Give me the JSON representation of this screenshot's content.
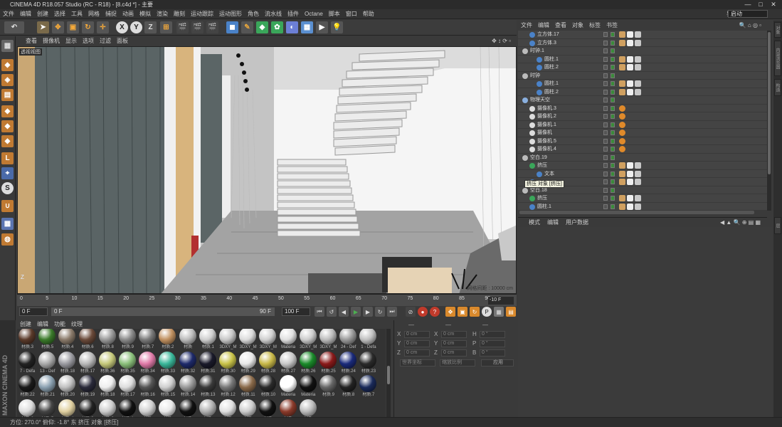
{
  "window": {
    "title": "CINEMA 4D R18.057 Studio (RC - R18) - [8.c4d *] - 主要",
    "min": "—",
    "max": "□",
    "close": "✕"
  },
  "menu": [
    "文件",
    "编辑",
    "创建",
    "选择",
    "工具",
    "网格",
    "捕捉",
    "动画",
    "模拟",
    "渲染",
    "雕刻",
    "运动跟踪",
    "运动图形",
    "角色",
    "流水线",
    "插件",
    "Octane",
    "脚本",
    "窗口",
    "帮助"
  ],
  "layout": {
    "label": "界面",
    "value": "启动"
  },
  "toolbar": {
    "x_label": "X",
    "y_label": "Y",
    "z_label": "Z"
  },
  "viewport": {
    "menu": [
      "查看",
      "摄像机",
      "显示",
      "选项",
      "过滤",
      "面板"
    ],
    "label": "透视视图",
    "scale_label": "网格间距 : 10000 cm"
  },
  "timeline": {
    "ticks": [
      "0",
      "5",
      "10",
      "15",
      "20",
      "25",
      "30",
      "35",
      "40",
      "45",
      "50",
      "55",
      "60",
      "65",
      "70",
      "75",
      "80",
      "85",
      "90"
    ],
    "end_frame": "-10 F"
  },
  "transport": {
    "start": "0 F",
    "current": "0 F",
    "range_end": "90 F",
    "max": "100 F"
  },
  "material_menu": [
    "创建",
    "编辑",
    "功能",
    "纹理"
  ],
  "materials": [
    "材质.3",
    "材质.5",
    "材质.4",
    "材质.6",
    "材质.8",
    "材质.9",
    "材质.7",
    "材质.2",
    "材质",
    "材质.1",
    "3DXY_M",
    "3DXY_M",
    "3DXY_M",
    "Materia",
    "3DXY_M",
    "3DXY_M",
    "24 - Def",
    "1 - Defa",
    "7 - Defa",
    "13 - Def",
    "材质.18",
    "材质.17",
    "材质.36",
    "材质.35",
    "材质.34",
    "材质.33",
    "材质.32",
    "材质.31",
    "材质.30",
    "材质.29",
    "材质.28",
    "材质.27",
    "材质.26",
    "材质.25",
    "材质.24",
    "材质.23",
    "材质.22",
    "材质.21",
    "材质.20",
    "材质.19",
    "材质.18",
    "材质.17",
    "材质.16",
    "材质.15",
    "材质.14",
    "材质.13",
    "材质.12",
    "材质.11",
    "材质.10",
    "Materia",
    "Materia",
    "材质.9",
    "材质.8",
    "材质.7",
    "材质.6",
    "材质.5",
    "材质.4",
    "材质.3",
    "材质.2",
    "材质.1",
    "材质",
    "材质",
    "材质",
    "材质",
    "材质",
    "材质",
    "材质",
    "材质",
    "材质"
  ],
  "coords": {
    "header": [
      "—",
      "—",
      "—"
    ],
    "rows": [
      [
        "X",
        "0 cm",
        "X",
        "0 cm",
        "H",
        "0 °"
      ],
      [
        "Y",
        "0 cm",
        "Y",
        "0 cm",
        "P",
        "0 °"
      ],
      [
        "Z",
        "0 cm",
        "Z",
        "0 cm",
        "B",
        "0 °"
      ]
    ],
    "mode1": "世界坐标",
    "mode2": "缩放比例",
    "apply": "应用"
  },
  "object_menu": [
    "文件",
    "编辑",
    "查看",
    "对象",
    "标签",
    "书签"
  ],
  "objects": [
    {
      "name": "立方体.17",
      "indent": 1,
      "icon": "cube"
    },
    {
      "name": "立方体.3",
      "indent": 1,
      "icon": "cube"
    },
    {
      "name": "时钟.1",
      "indent": 0,
      "icon": "null"
    },
    {
      "name": "圆柱.1",
      "indent": 2,
      "icon": "cyl"
    },
    {
      "name": "圆柱.2",
      "indent": 2,
      "icon": "cyl"
    },
    {
      "name": "时钟",
      "indent": 0,
      "icon": "null"
    },
    {
      "name": "圆柱.1",
      "indent": 2,
      "icon": "cyl"
    },
    {
      "name": "圆柱.2",
      "indent": 2,
      "icon": "cyl"
    },
    {
      "name": "物理天空",
      "indent": 0,
      "icon": "sky"
    },
    {
      "name": "摄像机.3",
      "indent": 1,
      "icon": "cam"
    },
    {
      "name": "摄像机.2",
      "indent": 1,
      "icon": "cam"
    },
    {
      "name": "摄像机.1",
      "indent": 1,
      "icon": "cam"
    },
    {
      "name": "摄像机",
      "indent": 1,
      "icon": "cam"
    },
    {
      "name": "摄像机.5",
      "indent": 1,
      "icon": "cam"
    },
    {
      "name": "摄像机.4",
      "indent": 1,
      "icon": "cam"
    },
    {
      "name": "空白.19",
      "indent": 0,
      "icon": "null"
    },
    {
      "name": "挤压",
      "indent": 1,
      "icon": "ext"
    },
    {
      "name": "文本",
      "indent": 2,
      "icon": "text"
    },
    {
      "name": "",
      "indent": 1,
      "icon": "cyl"
    },
    {
      "name": "空白.18",
      "indent": 0,
      "icon": "null"
    },
    {
      "name": "挤压",
      "indent": 1,
      "icon": "ext"
    },
    {
      "name": "圆柱.1",
      "indent": 1,
      "icon": "cyl"
    }
  ],
  "tooltip": "挤压 对象 [挤压]",
  "attr_menu": [
    "模式",
    "编辑",
    "用户数据"
  ],
  "side_tabs": [
    "对象",
    "内容浏览器",
    "构造",
    "层"
  ],
  "status": "方位: 270.0° 俯仰: -1.8° 东   挤压 对象 [挤压]"
}
